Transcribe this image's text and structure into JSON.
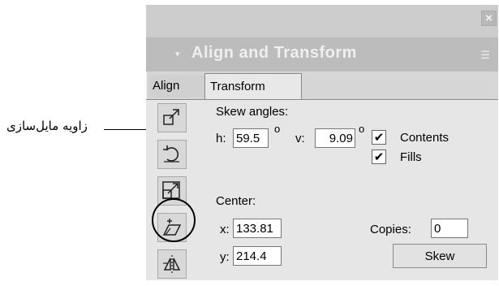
{
  "annotation": {
    "text": "زاویه مایل‌سازی"
  },
  "panel": {
    "title": "Align and Transform",
    "title_arrow": "▾",
    "close_glyph": "×",
    "menu_glyph": "☰"
  },
  "tabs": [
    "Align",
    "Transform"
  ],
  "skew": {
    "heading": "Skew angles:",
    "h_label": "h:",
    "h_value": "59.5",
    "v_label": "v:",
    "v_value": "9.09",
    "degree_symbol": "o"
  },
  "options": {
    "contents_label": "Contents",
    "contents_checked": "✔",
    "fills_label": "Fills",
    "fills_checked": "✔"
  },
  "center": {
    "heading": "Center:",
    "x_label": "x:",
    "x_value": "133.81",
    "y_label": "y:",
    "y_value": "214.4"
  },
  "copies": {
    "label": "Copies:",
    "value": "0"
  },
  "skew_button": "Skew",
  "tools": [
    "resize-icon",
    "rotate-icon",
    "scale-icon",
    "skew-icon",
    "mirror-icon"
  ]
}
